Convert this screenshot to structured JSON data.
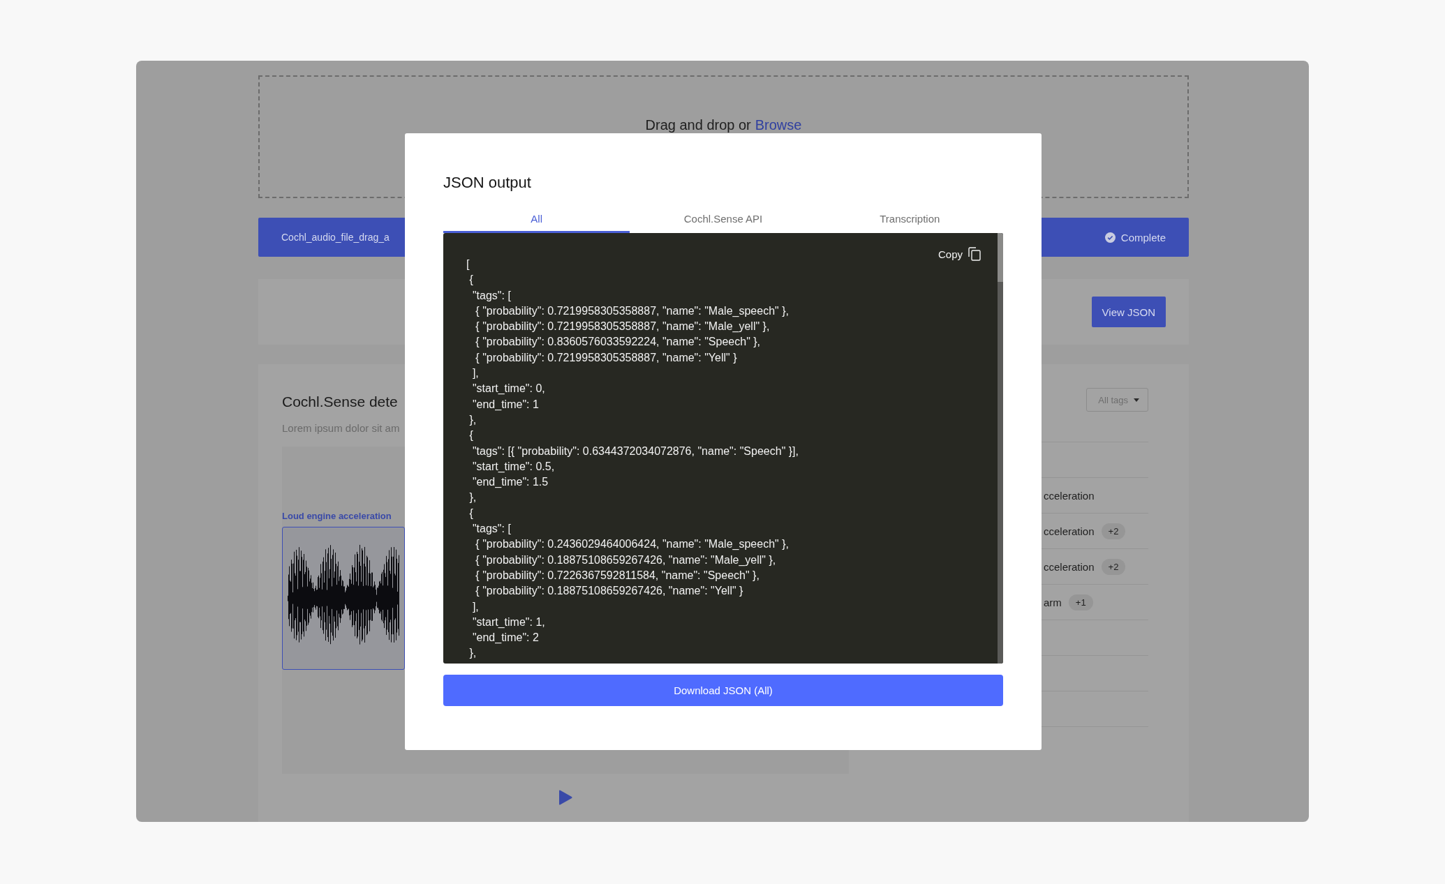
{
  "upload": {
    "prompt": "Drag and drop or",
    "link": "Browse"
  },
  "file_bar": {
    "file_name": "Cochl_audio_file_drag_a",
    "status": "Complete"
  },
  "view_json_button": "View JSON",
  "results": {
    "title": "Cochl.Sense dete",
    "description": "Lorem ipsum dolor sit am",
    "segment_label": "Loud engine acceleration",
    "filter": "All tags",
    "rows": [
      {
        "label": "cceleration"
      },
      {
        "label": "cceleration",
        "extra": "+2"
      },
      {
        "label": "cceleration",
        "extra": "+2"
      },
      {
        "label": "arm",
        "extra": "+1"
      }
    ]
  },
  "modal": {
    "title": "JSON output",
    "tabs": [
      {
        "label": "All",
        "selected": true
      },
      {
        "label": "Cochl.Sense API",
        "selected": false
      },
      {
        "label": "Transcription",
        "selected": false
      }
    ],
    "copy_label": "Copy",
    "code_lines": [
      "[",
      " {",
      "  \"tags\": [",
      "   { \"probability\": 0.7219958305358887, \"name\": \"Male_speech\" },",
      "   { \"probability\": 0.7219958305358887, \"name\": \"Male_yell\" },",
      "   { \"probability\": 0.8360576033592224, \"name\": \"Speech\" },",
      "   { \"probability\": 0.7219958305358887, \"name\": \"Yell\" }",
      "  ],",
      "  \"start_time\": 0,",
      "  \"end_time\": 1",
      " },",
      " {",
      "  \"tags\": [{ \"probability\": 0.6344372034072876, \"name\": \"Speech\" }],",
      "  \"start_time\": 0.5,",
      "  \"end_time\": 1.5",
      " },",
      " {",
      "  \"tags\": [",
      "   { \"probability\": 0.2436029464006424, \"name\": \"Male_speech\" },",
      "   { \"probability\": 0.18875108659267426, \"name\": \"Male_yell\" },",
      "   { \"probability\": 0.7226367592811584, \"name\": \"Speech\" },",
      "   { \"probability\": 0.18875108659267426, \"name\": \"Yell\" }",
      "  ],",
      "  \"start_time\": 1,",
      "  \"end_time\": 2",
      " },"
    ],
    "download_button": "Download JSON (All)"
  }
}
